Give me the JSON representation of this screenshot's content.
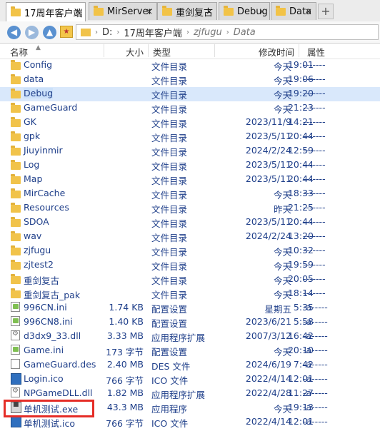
{
  "tabs": [
    {
      "label": "17周年客户端",
      "active": true
    },
    {
      "label": "MirServer",
      "active": false
    },
    {
      "label": "重剑复古",
      "active": false
    },
    {
      "label": "Debug",
      "active": false
    },
    {
      "label": "Data",
      "active": false
    }
  ],
  "tab_close_glyph": "×",
  "tab_add_glyph": "+",
  "address": {
    "drive": "D:",
    "segments": [
      "17周年客户端",
      "zjfugu",
      "Data"
    ],
    "separator": "›"
  },
  "columns": {
    "name": "名称",
    "size": "大小",
    "type": "类型",
    "modified": "修改时间",
    "attributes": "属性"
  },
  "files": [
    {
      "name": "Config",
      "icon": "folder-icon",
      "size": "",
      "type": "文件目录",
      "date": "今天",
      "time": "19:01",
      "attr": "-------"
    },
    {
      "name": "data",
      "icon": "folder-icon",
      "size": "",
      "type": "文件目录",
      "date": "今天",
      "time": "19:06",
      "attr": "-------"
    },
    {
      "name": "Debug",
      "icon": "folder-icon",
      "size": "",
      "type": "文件目录",
      "date": "今天",
      "time": "19:20",
      "attr": "-------"
    },
    {
      "name": "GameGuard",
      "icon": "folder-icon",
      "size": "",
      "type": "文件目录",
      "date": "今天",
      "time": "21:23",
      "attr": "-------"
    },
    {
      "name": "GK",
      "icon": "folder-icon",
      "size": "",
      "type": "文件目录",
      "date": "2023/11/9",
      "time": "14:21",
      "attr": "-------"
    },
    {
      "name": "gpk",
      "icon": "folder-icon",
      "size": "",
      "type": "文件目录",
      "date": "2023/5/11",
      "time": "20:44",
      "attr": "-------"
    },
    {
      "name": "Jiuyinmir",
      "icon": "folder-icon",
      "size": "",
      "type": "文件目录",
      "date": "2024/2/24",
      "time": "12:59",
      "attr": "-------"
    },
    {
      "name": "Log",
      "icon": "folder-icon",
      "size": "",
      "type": "文件目录",
      "date": "2023/5/11",
      "time": "20:44",
      "attr": "-------"
    },
    {
      "name": "Map",
      "icon": "folder-icon",
      "size": "",
      "type": "文件目录",
      "date": "2023/5/11",
      "time": "20:44",
      "attr": "-------"
    },
    {
      "name": "MirCache",
      "icon": "folder-icon",
      "size": "",
      "type": "文件目录",
      "date": "今天",
      "time": "18:33",
      "attr": "-------"
    },
    {
      "name": "Resources",
      "icon": "folder-icon",
      "size": "",
      "type": "文件目录",
      "date": "昨天",
      "time": "21:25",
      "attr": "-------"
    },
    {
      "name": "SDOA",
      "icon": "folder-icon",
      "size": "",
      "type": "文件目录",
      "date": "2023/5/11",
      "time": "20:44",
      "attr": "-------"
    },
    {
      "name": "wav",
      "icon": "folder-icon",
      "size": "",
      "type": "文件目录",
      "date": "2024/2/24",
      "time": "13:20",
      "attr": "-------"
    },
    {
      "name": "zjfugu",
      "icon": "folder-icon",
      "size": "",
      "type": "文件目录",
      "date": "今天",
      "time": "10:32",
      "attr": "-------"
    },
    {
      "name": "zjtest2",
      "icon": "folder-icon",
      "size": "",
      "type": "文件目录",
      "date": "今天",
      "time": "19:59",
      "attr": "-------"
    },
    {
      "name": "重剑复古",
      "icon": "folder-icon",
      "size": "",
      "type": "文件目录",
      "date": "今天",
      "time": "20:05",
      "attr": "-------"
    },
    {
      "name": "重剑复古_pak",
      "icon": "folder-icon",
      "size": "",
      "type": "文件目录",
      "date": "今天",
      "time": "18:14",
      "attr": "-------"
    },
    {
      "name": "996CN.ini",
      "icon": "ini-file-icon",
      "size": "1.74 KB",
      "type": "配置设置",
      "date": "星期五",
      "time": "5:35",
      "attr": "-a-----"
    },
    {
      "name": "996CN8.ini",
      "icon": "ini-file-icon",
      "size": "1.40 KB",
      "type": "配置设置",
      "date": "2023/6/21",
      "time": "5:58",
      "attr": "-a-----"
    },
    {
      "name": "d3dx9_33.dll",
      "icon": "dll-file-icon",
      "size": "3.33 MB",
      "type": "应用程序扩展",
      "date": "2007/3/12",
      "time": "16:42",
      "attr": "-a-----"
    },
    {
      "name": "Game.ini",
      "icon": "ini-file-icon",
      "size": "173 字节",
      "type": "配置设置",
      "date": "今天",
      "time": "20:10",
      "attr": "-a-----"
    },
    {
      "name": "GameGuard.des",
      "icon": "generic-file-icon",
      "size": "2.40 MB",
      "type": "DES 文件",
      "date": "2024/6/19",
      "time": "7:42",
      "attr": "-a-----"
    },
    {
      "name": "Login.ico",
      "icon": "ico-file-icon",
      "size": "766 字节",
      "type": "ICO 文件",
      "date": "2022/4/14",
      "time": "12:01",
      "attr": "-a-----"
    },
    {
      "name": "NPGameDLL.dll",
      "icon": "dll-file-icon",
      "size": "1.82 MB",
      "type": "应用程序扩展",
      "date": "2022/4/28",
      "time": "11:27",
      "attr": "-a-----"
    },
    {
      "name": "单机测试.exe",
      "icon": "exe-file-icon",
      "size": "43.3 MB",
      "type": "应用程序",
      "date": "今天",
      "time": "19:13",
      "attr": "-a-----"
    },
    {
      "name": "单机测试.ico",
      "icon": "ico-file-icon",
      "size": "766 字节",
      "type": "ICO 文件",
      "date": "2022/4/14",
      "time": "12:01",
      "attr": "-a-----"
    }
  ],
  "colors": {
    "folder": "#f1c34a",
    "text": "#1f3f8a",
    "highlight_box": "#e52d27",
    "selected_row": "#d9e8fb"
  }
}
